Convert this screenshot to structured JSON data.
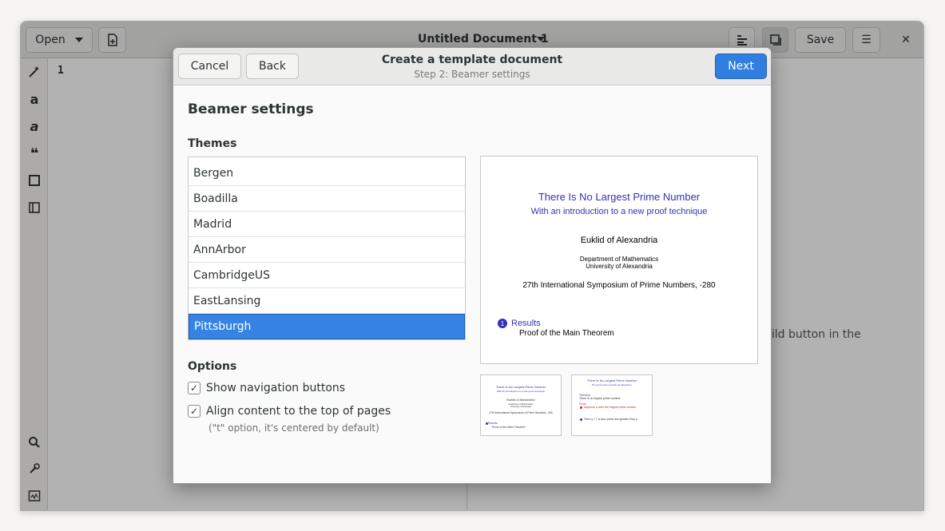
{
  "window": {
    "open_label": "Open",
    "title": "Untitled Document 1",
    "save_label": "Save",
    "close_glyph": "✕",
    "menu_glyph": "☰",
    "line_number": "1",
    "preview_hint": "e build button in the"
  },
  "toolbar_icons": [
    "magic-wand-icon",
    "bold-icon",
    "italic-icon",
    "quote-icon",
    "box-icon",
    "sidebar-icon",
    "search-icon",
    "build-tools-icon",
    "terminal-icon"
  ],
  "dialog": {
    "cancel_label": "Cancel",
    "back_label": "Back",
    "next_label": "Next",
    "title": "Create a template document",
    "subtitle": "Step 2: Beamer settings",
    "section_title": "Beamer settings",
    "themes_label": "Themes",
    "themes": [
      "Bergen",
      "Boadilla",
      "Madrid",
      "AnnArbor",
      "CambridgeUS",
      "EastLansing",
      "Pittsburgh"
    ],
    "selected_theme": "Pittsburgh",
    "options_label": "Options",
    "options": [
      {
        "label": "Show navigation buttons",
        "checked": true
      },
      {
        "label": "Align content to the top of pages",
        "checked": true
      }
    ],
    "option_hint": "(\"t\" option, it's centered by default)"
  },
  "slide_preview": {
    "title": "There Is No Largest Prime Number",
    "subtitle": "With an introduction to a new proof technique",
    "author": "Euklid of Alexandria",
    "institute_line1": "Department of Mathematics",
    "institute_line2": "University of Alexandria",
    "conference": "27th International Symposium of Prime Numbers, -280",
    "section_number": "1",
    "section": "Results",
    "subsection": "Proof of the Main Theorem"
  },
  "thumb2": {
    "title": "There Is No Largest Prime Number",
    "subtitle": "The proof uses reductio ad absurdum.",
    "theorem_label": "Theorem",
    "theorem_text": "There is no largest prime number.",
    "proof_label": "Proof",
    "step1": "Suppose p were the largest prime number.",
    "step2": "Then q + 1 is also prime and greater than p."
  },
  "colors": {
    "accent": "#3584e4",
    "slide_blue": "#3333b3",
    "slide_red": "#cc2222"
  }
}
